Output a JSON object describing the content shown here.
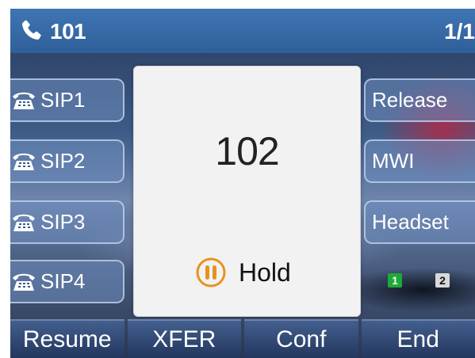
{
  "status_bar": {
    "line_number": "101",
    "page_indicator": "1/1",
    "phone_icon": "phone-handset-icon"
  },
  "line_keys_left": [
    {
      "label": "SIP1",
      "icon": "desk-phone-icon"
    },
    {
      "label": "SIP2",
      "icon": "desk-phone-icon"
    },
    {
      "label": "SIP3",
      "icon": "desk-phone-icon"
    },
    {
      "label": "SIP4",
      "icon": "desk-phone-icon"
    }
  ],
  "line_keys_right": [
    {
      "label": "Release"
    },
    {
      "label": "MWI"
    },
    {
      "label": "Headset"
    }
  ],
  "call": {
    "remote_number": "102",
    "state_label": "Hold",
    "state_icon": "pause-icon",
    "state_icon_color": "#e8921e"
  },
  "blf_indicators": [
    {
      "label": "1",
      "color": "#1fa83a"
    },
    {
      "label": "2",
      "color": "#d8d8d8"
    }
  ],
  "softkeys": [
    {
      "label": "Resume"
    },
    {
      "label": "XFER"
    },
    {
      "label": "Conf"
    },
    {
      "label": "End"
    }
  ],
  "colors": {
    "status_bar": "#3f75b4",
    "call_card": "#f2f2f2"
  }
}
